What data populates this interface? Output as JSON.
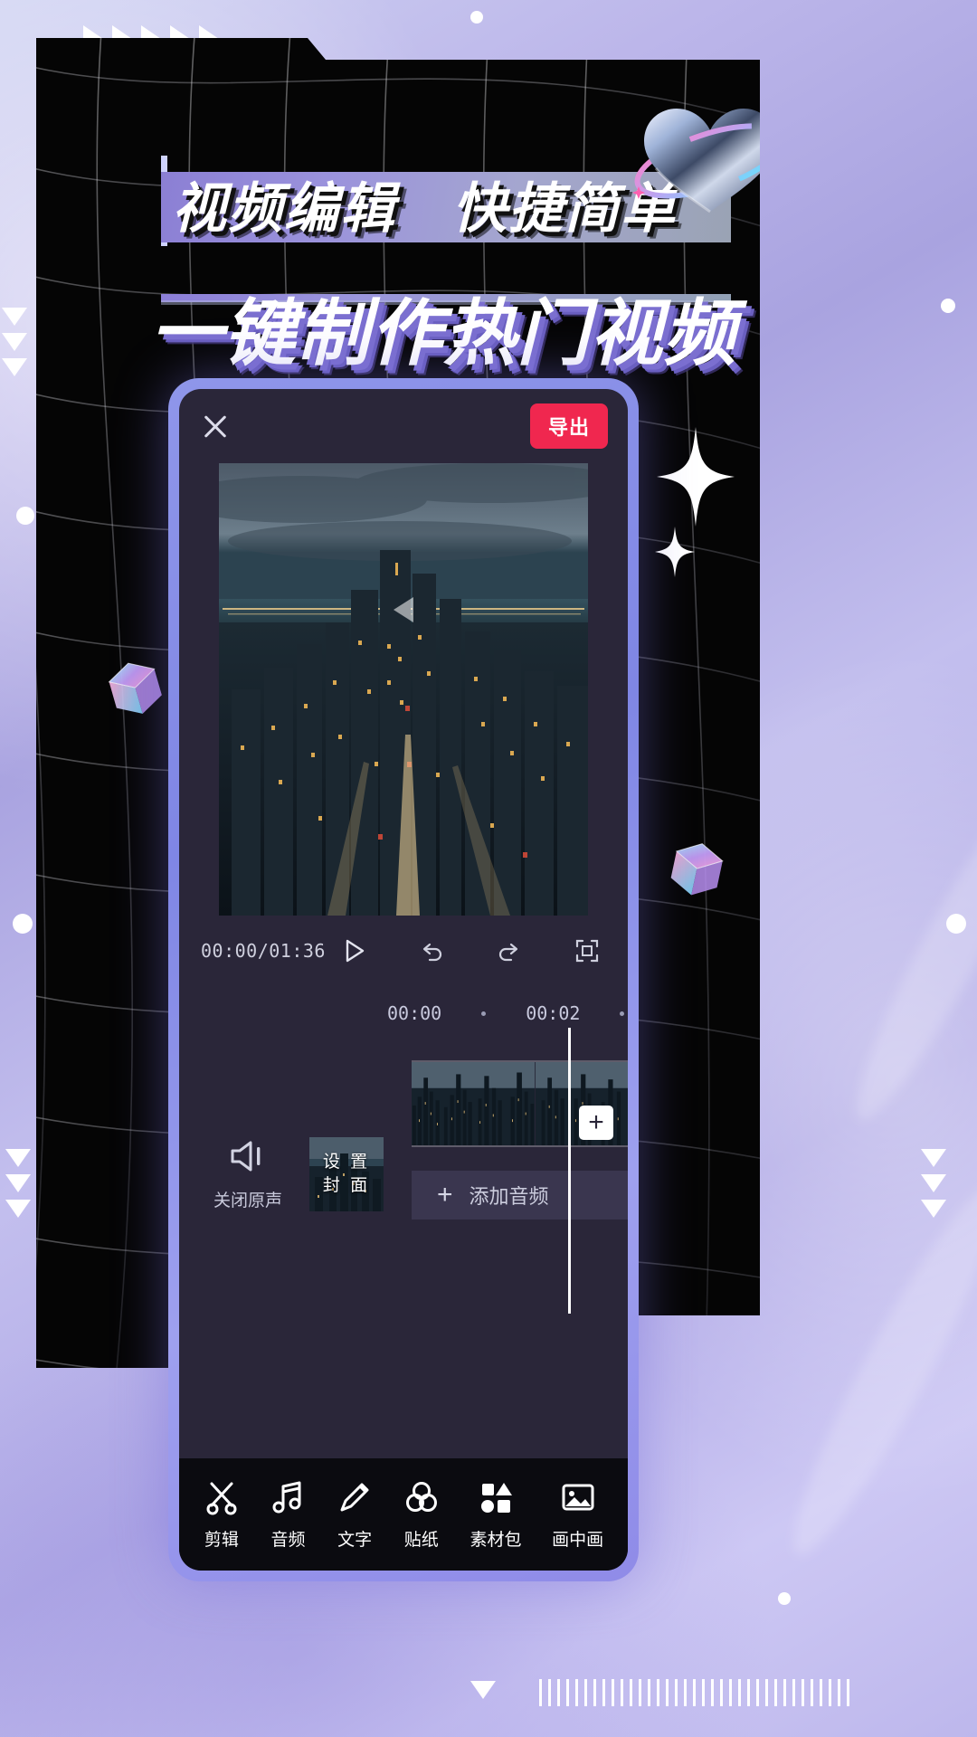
{
  "poster": {
    "headline_primary": "视频编辑　快捷简单",
    "headline_secondary": "一键制作热门视频"
  },
  "theme": {
    "accent_red": "#f0274f",
    "phone_frame": "#8f96ea",
    "screen_bg": "#2a2639",
    "toolbar_bg": "#0b0b10",
    "headline_shadow_purple": "#7b6fd0"
  },
  "app": {
    "topbar": {
      "close_icon": "close-icon",
      "export_label": "导出"
    },
    "preview": {
      "play_icon": "play-triangle-icon"
    },
    "controls": {
      "time_code": "00:00/01:36",
      "play_icon": "play-icon",
      "undo_icon": "undo-icon",
      "redo_icon": "redo-icon",
      "fullscreen_icon": "fullscreen-icon"
    },
    "timeline": {
      "ruler_marks": [
        "00:00",
        "·",
        "00:02",
        "·"
      ],
      "mute": {
        "icon": "speaker-mute-icon",
        "label": "关闭原声"
      },
      "cover": {
        "label": "设 置\n封 面"
      },
      "add_clip_label": "+",
      "audio_track": {
        "plus_icon": "plus-icon",
        "label": "添加音频"
      }
    },
    "toolbar": {
      "items": [
        {
          "label": "剪辑",
          "icon": "scissors-icon"
        },
        {
          "label": "音频",
          "icon": "music-note-icon"
        },
        {
          "label": "文字",
          "icon": "pencil-icon"
        },
        {
          "label": "贴纸",
          "icon": "sticker-circles-icon"
        },
        {
          "label": "素材包",
          "icon": "shapes-icon"
        },
        {
          "label": "画中画",
          "icon": "picture-in-picture-icon"
        }
      ]
    }
  }
}
